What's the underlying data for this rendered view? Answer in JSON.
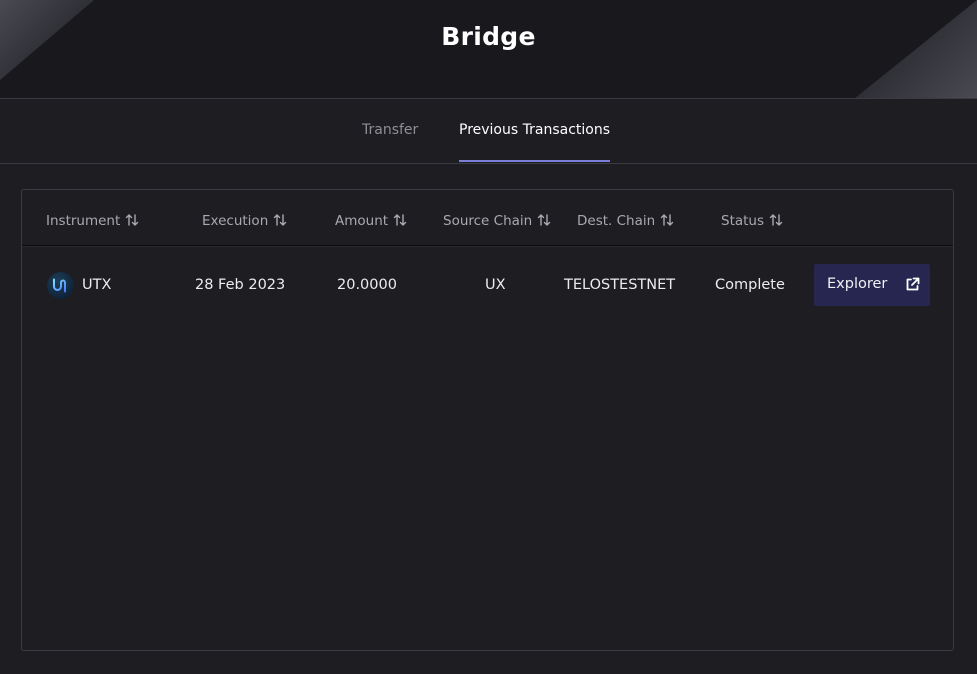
{
  "header": {
    "title": "Bridge"
  },
  "tabs": [
    {
      "label": "Transfer",
      "active": false
    },
    {
      "label": "Previous Transactions",
      "active": true
    }
  ],
  "table": {
    "columns": [
      "Instrument",
      "Execution",
      "Amount",
      "Source Chain",
      "Dest. Chain",
      "Status"
    ],
    "rows": [
      {
        "instrument": "UTX",
        "instrument_icon": "utx-coin-icon",
        "execution": "28 Feb 2023",
        "amount": "20.0000",
        "source_chain": "UX",
        "dest_chain": "TELOSTESTNET",
        "status": "Complete",
        "action_label": "Explorer"
      }
    ]
  },
  "colors": {
    "background": "#1d1d22",
    "header_bg": "#19191d",
    "active_tab_underline": "#7b7fd6",
    "explorer_button": "#262650"
  }
}
